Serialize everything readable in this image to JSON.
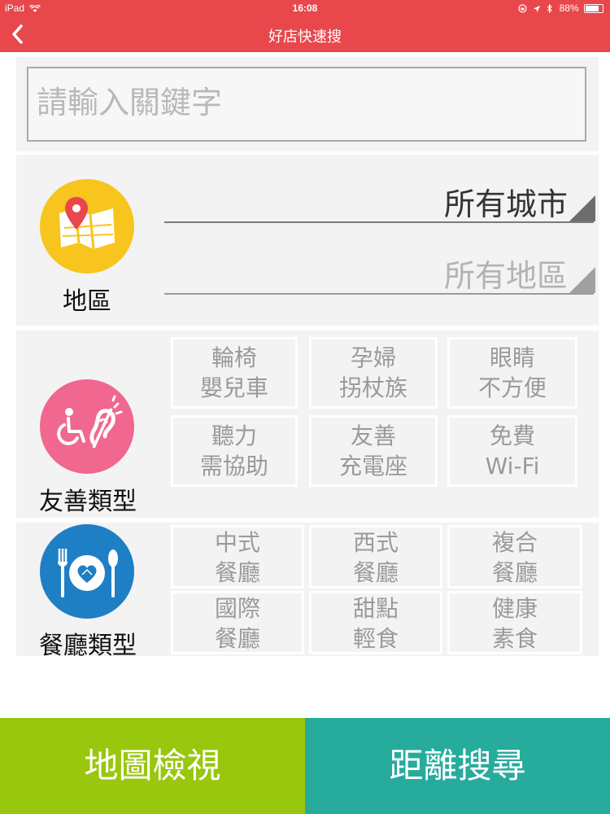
{
  "status_bar": {
    "device": "iPad",
    "time": "16:08",
    "battery": "88%"
  },
  "nav": {
    "back_icon": "chevron-left-icon",
    "title": "好店快速搜"
  },
  "search": {
    "placeholder": "請輸入關鍵字"
  },
  "region": {
    "label": "地區",
    "icon": "map-pin-icon",
    "city": "所有城市",
    "district": "所有地區"
  },
  "friendly": {
    "label": "友善類型",
    "icon": "accessibility-icon",
    "options": [
      {
        "line1": "輪椅",
        "line2": "嬰兒車"
      },
      {
        "line1": "孕婦",
        "line2": "拐杖族"
      },
      {
        "line1": "眼睛",
        "line2": "不方便"
      },
      {
        "line1": "聽力",
        "line2": "需協助"
      },
      {
        "line1": "友善",
        "line2": "充電座"
      },
      {
        "line1": "免費",
        "line2": "Wi-Fi"
      }
    ]
  },
  "restaurant": {
    "label": "餐廳類型",
    "icon": "dining-plate-icon",
    "options": [
      {
        "line1": "中式",
        "line2": "餐廳"
      },
      {
        "line1": "西式",
        "line2": "餐廳"
      },
      {
        "line1": "複合",
        "line2": "餐廳"
      },
      {
        "line1": "國際",
        "line2": "餐廳"
      },
      {
        "line1": "甜點",
        "line2": "輕食"
      },
      {
        "line1": "健康",
        "line2": "素食"
      }
    ]
  },
  "actions": {
    "map_view": "地圖檢視",
    "distance_search": "距離搜尋"
  },
  "colors": {
    "header": "#e8474b",
    "region_icon": "#f7c51e",
    "friendly_icon": "#f0678f",
    "restaurant_icon": "#1e7fc4",
    "map_button": "#99c70d",
    "distance_button": "#27ab9d"
  }
}
